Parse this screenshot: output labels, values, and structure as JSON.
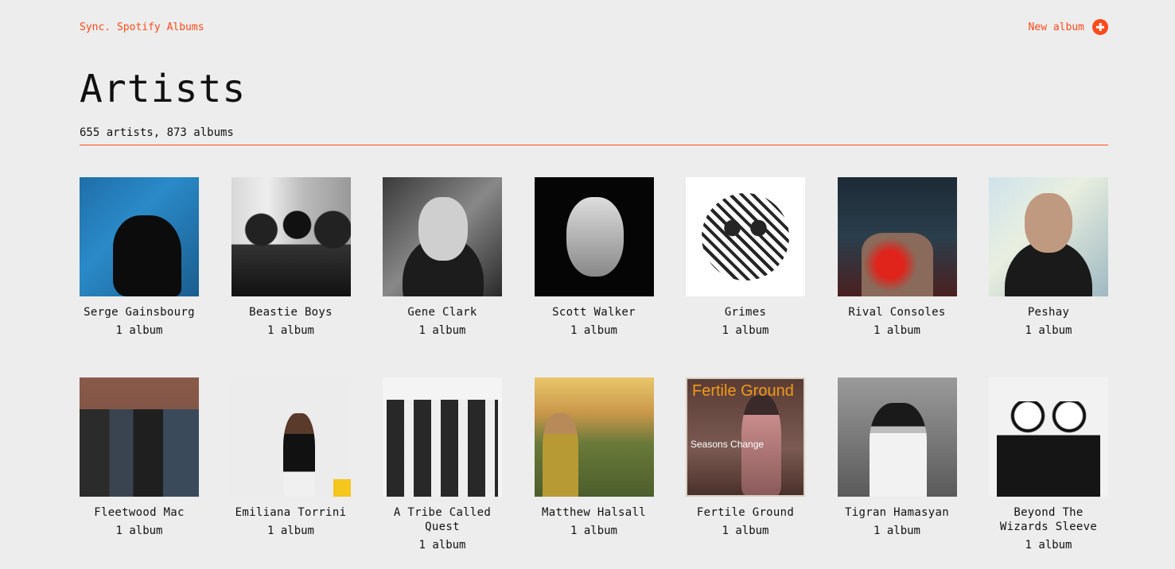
{
  "header": {
    "sync_label": "Sync. Spotify Albums",
    "new_album_label": "New album",
    "new_album_icon": "plus-circle-icon",
    "accent_color": "#ff4a1c"
  },
  "page": {
    "title": "Artists",
    "summary": "655 artists, 873 albums"
  },
  "artists": [
    {
      "name": "Serge Gainsbourg",
      "count": "1 album"
    },
    {
      "name": "Beastie Boys",
      "count": "1 album"
    },
    {
      "name": "Gene Clark",
      "count": "1 album"
    },
    {
      "name": "Scott Walker",
      "count": "1 album"
    },
    {
      "name": "Grimes",
      "count": "1 album"
    },
    {
      "name": "Rival Consoles",
      "count": "1 album"
    },
    {
      "name": "Peshay",
      "count": "1 album"
    },
    {
      "name": "Fleetwood Mac",
      "count": "1 album"
    },
    {
      "name": "Emiliana Torrini",
      "count": "1 album"
    },
    {
      "name": "A Tribe Called Quest",
      "count": "1 album"
    },
    {
      "name": "Matthew Halsall",
      "count": "1 album"
    },
    {
      "name": "Fertile Ground",
      "count": "1 album",
      "cover_title": "Fertile Ground",
      "cover_subtitle": "Seasons Change"
    },
    {
      "name": "Tigran Hamasyan",
      "count": "1 album"
    },
    {
      "name": "Beyond The Wizards Sleeve",
      "count": "1 album"
    }
  ]
}
